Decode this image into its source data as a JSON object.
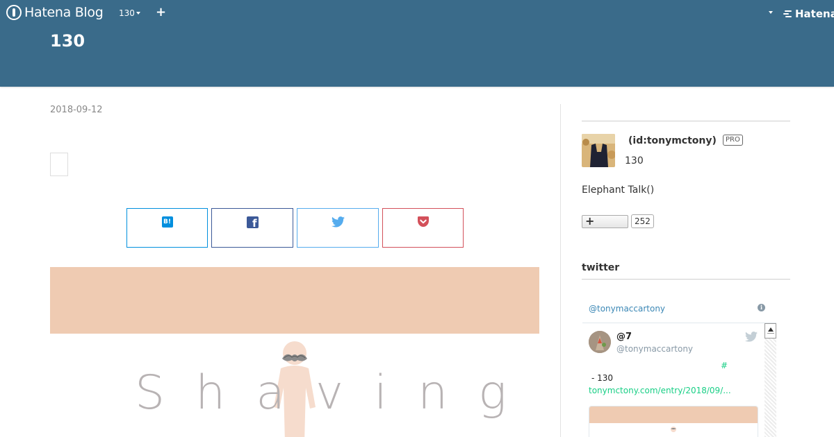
{
  "navbar": {
    "brand": "Hatena Blog",
    "blog_menu": "130",
    "add_label": "+",
    "hatena_brand": "Hatena"
  },
  "header": {
    "blog_title": "130"
  },
  "entry": {
    "date": "2018-09-12",
    "share_buttons": [
      {
        "service": "hatena-bookmark",
        "label": "B!",
        "color": "#008fde"
      },
      {
        "service": "facebook",
        "color": "#3b5998"
      },
      {
        "service": "twitter",
        "color": "#55acee"
      },
      {
        "service": "pocket",
        "color": "#d3505a"
      }
    ],
    "eyecatch_color": "#efcbb2",
    "hero_word": "Shaving"
  },
  "sidebar": {
    "profile": {
      "name": "(id:tonymctony)",
      "badge": "PRO",
      "count": "130",
      "description": "Elephant Talk()",
      "follow_icon": "+",
      "follower_count": "252"
    },
    "twitter": {
      "heading": "twitter",
      "timeline_handle": "@tonymaccartony",
      "info_icon": "i",
      "tweet": {
        "name": "@7",
        "username": "@tonymaccartony",
        "hashtag": "#",
        "text": "- 130",
        "link": "tonymctony.com/entry/2018/09/..."
      }
    }
  },
  "colors": {
    "header_bg": "#3a6b8a",
    "link": "#3b87b5",
    "tweet_link": "#19cf86"
  }
}
